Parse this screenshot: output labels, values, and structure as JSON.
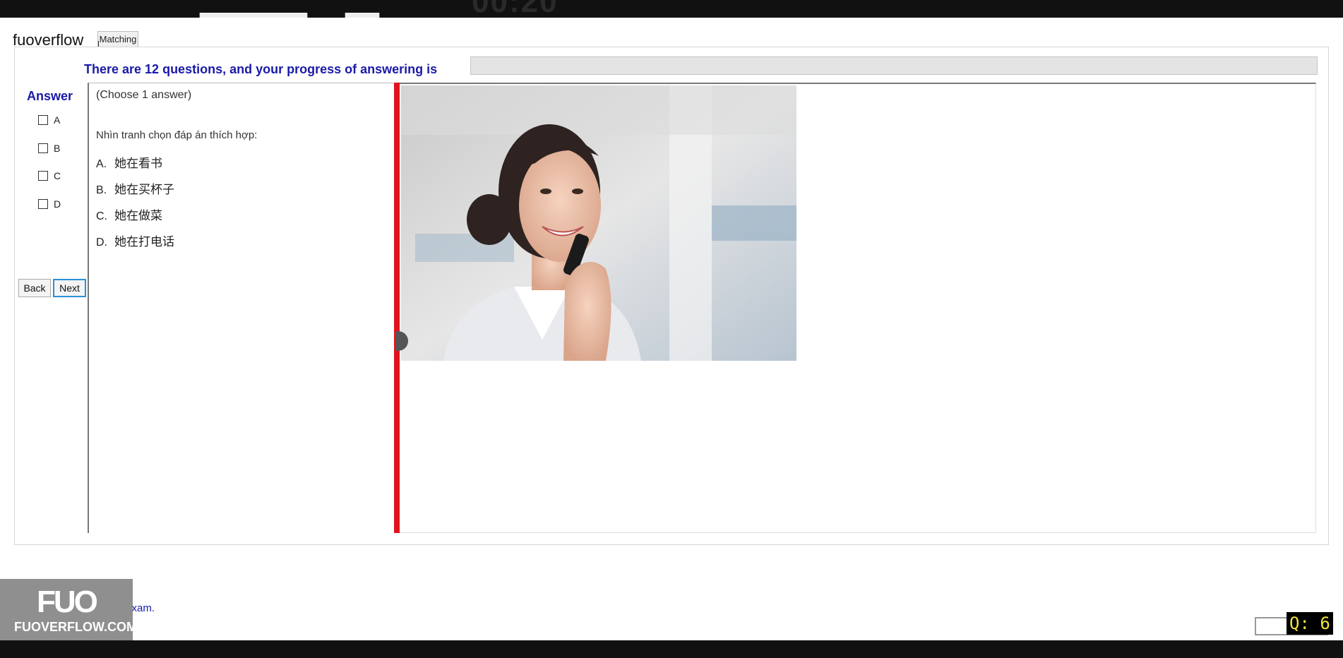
{
  "header": {
    "app_title": "fuoverflow",
    "tab_label": "Matching"
  },
  "progress": {
    "text": "There are 12 questions, and your progress of answering is",
    "value": 0
  },
  "answer": {
    "label": "Answer",
    "options": [
      "A",
      "B",
      "C",
      "D"
    ]
  },
  "nav": {
    "back_label": "Back",
    "next_label": "Next"
  },
  "question": {
    "choose": "(Choose 1 answer)",
    "instruction": "Nhìn tranh chọn đáp án thích hợp:",
    "options": [
      {
        "letter": "A.",
        "text": "她在看书"
      },
      {
        "letter": "B.",
        "text": "她在买杯子"
      },
      {
        "letter": "C.",
        "text": "她在做菜"
      },
      {
        "letter": "D.",
        "text": "她在打电话"
      }
    ]
  },
  "footer": {
    "finish_text": "finish the exam.",
    "watermark_logo": "FUO",
    "watermark_site": "FUOVERFLOW.COM",
    "question_counter": "Q: 6"
  },
  "colors": {
    "accent_blue": "#1a1aa8",
    "splitter_red": "#e0141c",
    "counter_yellow": "#f2e33b"
  }
}
